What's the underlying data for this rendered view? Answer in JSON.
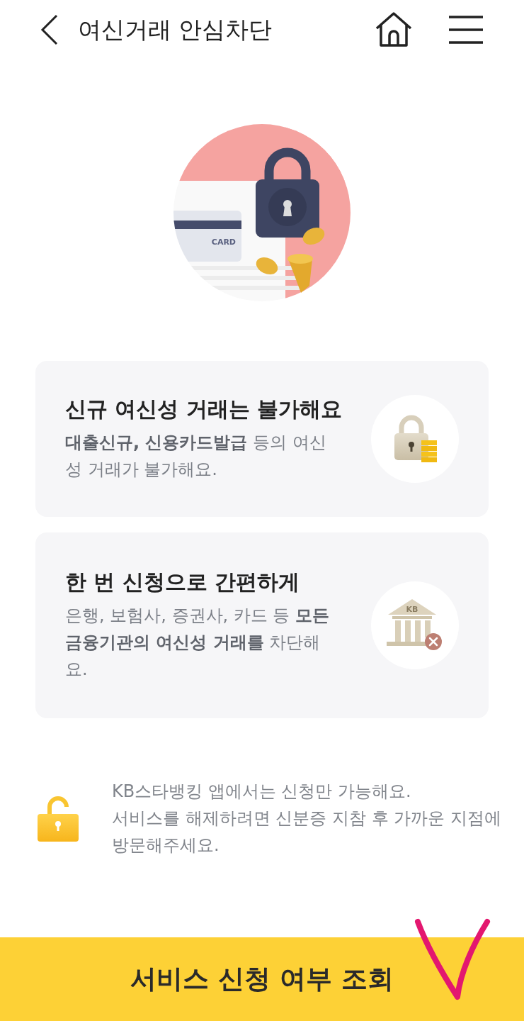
{
  "header": {
    "title": "여신거래 안심차단"
  },
  "hero": {
    "card_label": "CARD"
  },
  "cards": [
    {
      "kind": "lock",
      "title": "신규 여신성 거래는 불가해요",
      "description": "**대출신규, 신용카드발급** 등의 여신성 거래가 불가해요."
    },
    {
      "kind": "bank",
      "title": "한 번 신청으로 간편하게",
      "description": "은행, 보험사, 증권사, 카드 등 **모든 금융기관의 여신성 거래를** 차단해요.",
      "icon_label": "KB"
    }
  ],
  "notice": {
    "lines": [
      "KB스타뱅킹 앱에서는 신청만 가능해요.",
      "서비스를 해제하려면 신분증 지참 후 가까운 지점에 방문해주세요."
    ]
  },
  "button": {
    "label": "서비스 신청 여부 조회"
  }
}
